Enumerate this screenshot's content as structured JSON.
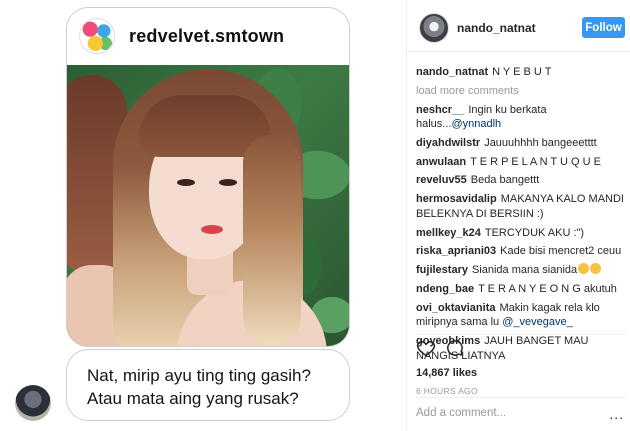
{
  "post": {
    "account": "redvelvet.smtown",
    "caption_lines": [
      "Nat, mirip ayu ting ting gasih?",
      "Atau mata aing yang rusak?"
    ]
  },
  "sidebar": {
    "username": "nando_natnat",
    "follow_label": "Follow",
    "caption": {
      "user": "nando_natnat",
      "text": "N Y E B U T"
    },
    "load_more": "load more comments",
    "comments": [
      {
        "user": "neshcr__",
        "text": "Ingin ku berkata halus...",
        "mention": "@ynnadlh"
      },
      {
        "user": "diyahdwilstr",
        "text": "Jauuuhhhh bangeeetttt"
      },
      {
        "user": "anwulaan",
        "text": "T E R P E L A N T U Q U E"
      },
      {
        "user": "reveluv55",
        "text": "Beda bangettt"
      },
      {
        "user": "hermosavidalip",
        "text": "MAKANYA KALO MANDI BELEKNYA DI BERSIIN :)"
      },
      {
        "user": "mellkey_k24",
        "text": "TERCYDUK AKU :\")"
      },
      {
        "user": "riska_apriani03",
        "text": "Kade bisi mencret2 ceuu"
      },
      {
        "user": "fujilestary",
        "text": "Sianida mana sianida",
        "emoji_count": 2
      },
      {
        "user": "ndeng_bae",
        "text": "T E R A N Y E O N G akutuh"
      },
      {
        "user": "ovi_oktavianita",
        "text": "Makin kagak rela klo miripnya sama lu ",
        "mention": "@_vevegave_"
      },
      {
        "user": "goyeobkims",
        "text": "JAUH BANGET MAU NANGIS LIATNYA"
      }
    ],
    "likes": "14,867 likes",
    "time_ago": "6 HOURS AGO",
    "add_comment_placeholder": "Add a comment...",
    "more_label": "..."
  },
  "colors": {
    "follow_button": "#3897f0",
    "mention": "#003569",
    "muted": "#999999"
  },
  "icons": [
    "heart-icon",
    "comment-icon"
  ]
}
